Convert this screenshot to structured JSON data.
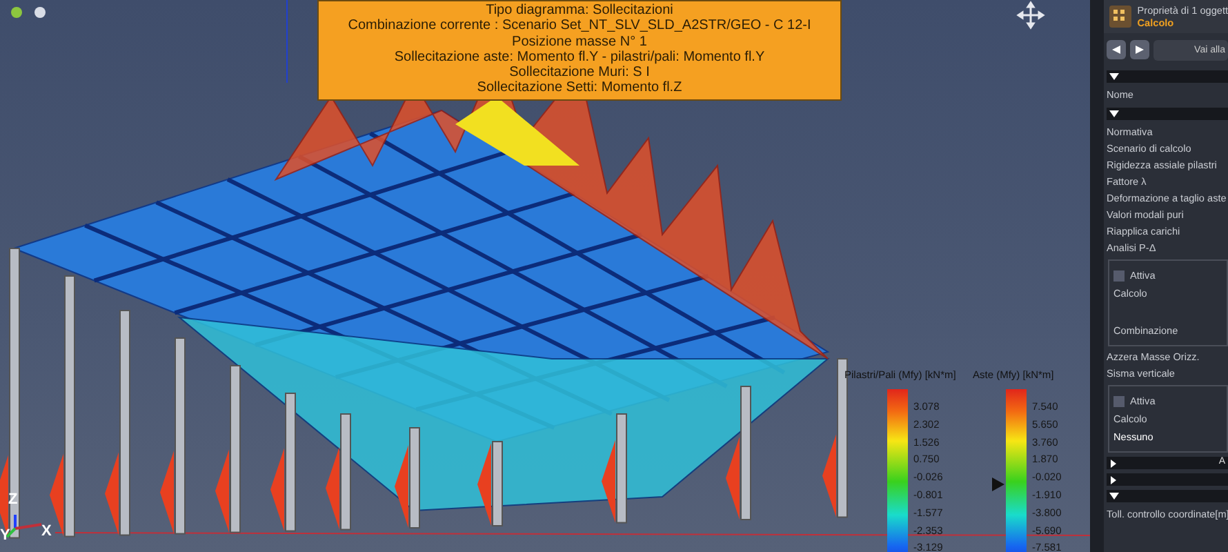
{
  "info_box": {
    "lines": [
      "Tipo diagramma: Sollecitazioni",
      "Combinazione corrente : Scenario Set_NT_SLV_SLD_A2STR/GEO - C 12-I",
      "Posizione masse N° 1",
      "Sollecitazione aste: Momento fl.Y - pilastri/pali: Momento fl.Y",
      "Sollecitazione Muri: S I",
      "Sollecitazione Setti: Momento fl.Z"
    ]
  },
  "legends": [
    {
      "title": "Pilastri/Pali (Mfy) [kN*m]",
      "values": [
        "3.078",
        "2.302",
        "1.526",
        "0.750",
        "-0.026",
        "-0.801",
        "-1.577",
        "-2.353",
        "-3.129"
      ]
    },
    {
      "title": "Aste (Mfy) [kN*m]",
      "values": [
        "7.540",
        "5.650",
        "3.760",
        "1.870",
        "-0.020",
        "-1.910",
        "-3.800",
        "-5.690",
        "-7.581"
      ],
      "pointer": true
    }
  ],
  "axes": {
    "z": "Z",
    "y": "Y",
    "x": "X"
  },
  "panel": {
    "title": "Proprietà di 1 oggett",
    "subtitle": "Calcolo",
    "nav_field": "Vai alla",
    "rows": [
      {
        "kind": "section",
        "expanded": true
      },
      {
        "kind": "label",
        "text": "Nome"
      },
      {
        "kind": "section",
        "expanded": true
      },
      {
        "kind": "label",
        "text": "Normativa"
      },
      {
        "kind": "label",
        "text": "Scenario di calcolo"
      },
      {
        "kind": "label",
        "text": "Rigidezza assiale pilastri"
      },
      {
        "kind": "label",
        "text": "Fattore λ"
      },
      {
        "kind": "label",
        "text": "Deformazione a taglio aste"
      },
      {
        "kind": "label",
        "text": "Valori modali puri"
      },
      {
        "kind": "label",
        "text": "Riapplica carichi"
      },
      {
        "kind": "label",
        "text": "Analisi P-Δ"
      },
      {
        "kind": "group",
        "checkbox": {
          "label": "Attiva",
          "checked": false
        },
        "lines": [
          {
            "text": "Calcolo",
            "value": false
          },
          {
            "text": "Combinazione",
            "value": false
          }
        ]
      },
      {
        "kind": "label",
        "text": "Azzera Masse Orizz."
      },
      {
        "kind": "label",
        "text": "Sisma verticale"
      },
      {
        "kind": "group",
        "checkbox": {
          "label": "Attiva",
          "checked": false
        },
        "lines": [
          {
            "text": "Calcolo",
            "value": false
          },
          {
            "text": "Nessuno",
            "value": true
          }
        ]
      },
      {
        "kind": "section",
        "expanded": false,
        "text": "A"
      },
      {
        "kind": "section",
        "expanded": false
      },
      {
        "kind": "section",
        "expanded": true
      },
      {
        "kind": "label",
        "text": "Toll. controllo coordinate[m]"
      }
    ]
  }
}
